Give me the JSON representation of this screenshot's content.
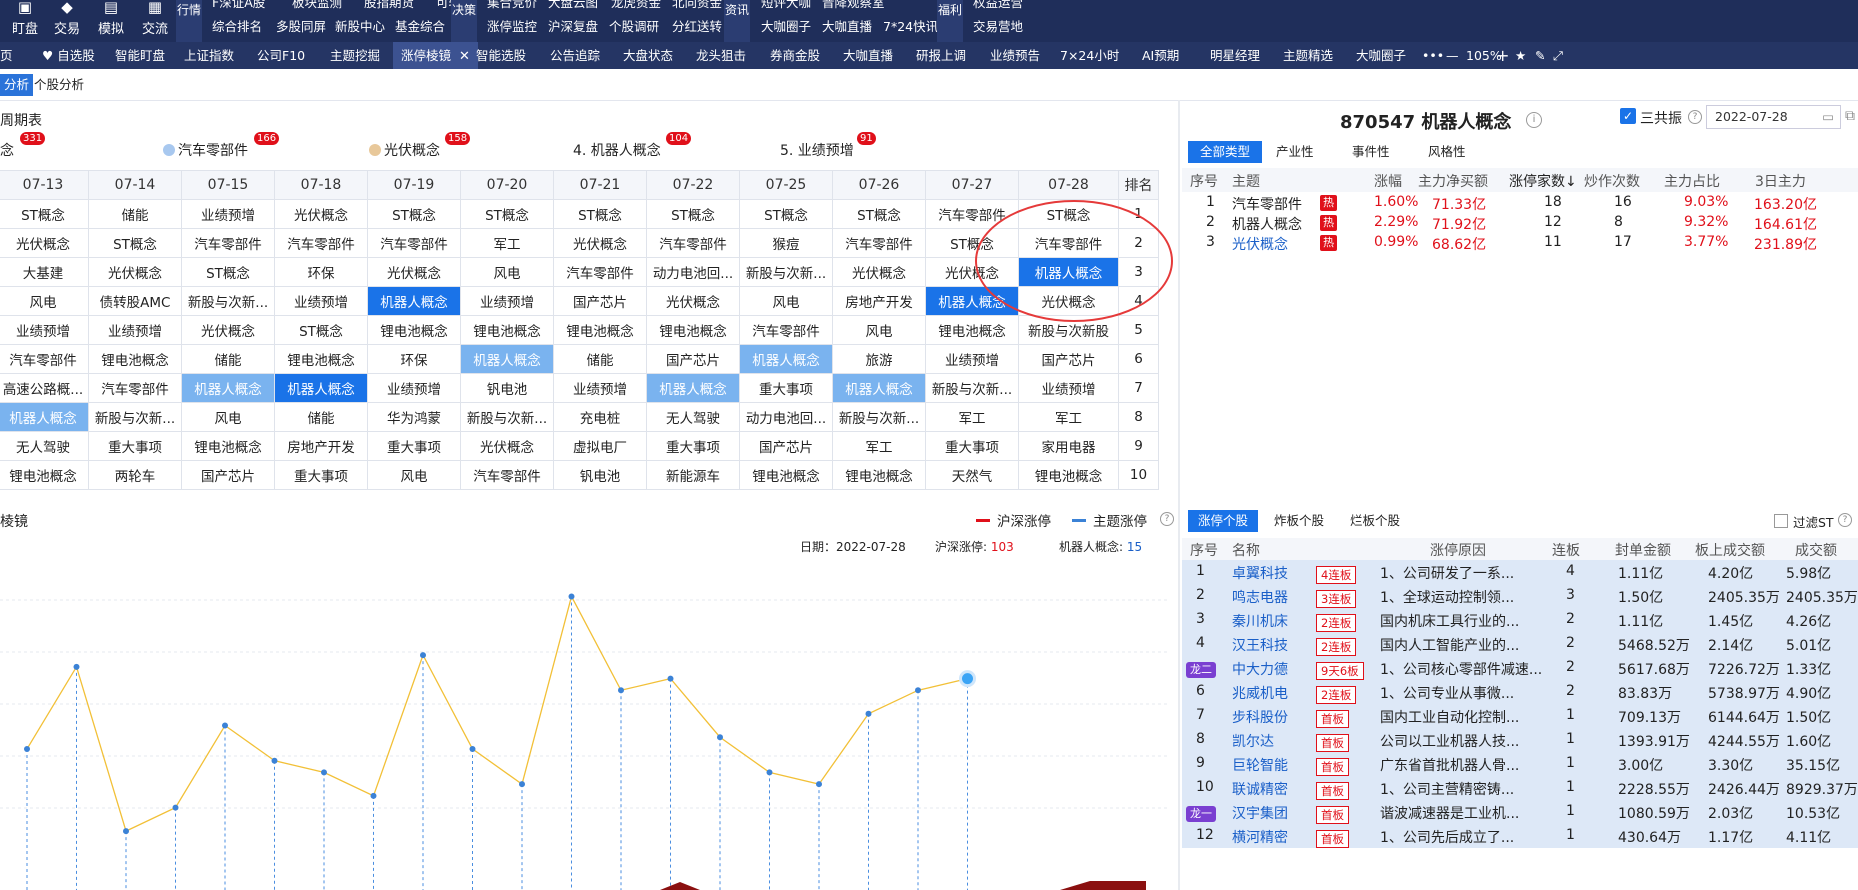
{
  "topnav": {
    "main": [
      {
        "icon": "chart-icon",
        "label": "盯盘"
      },
      {
        "icon": "trade-icon",
        "label": "交易"
      },
      {
        "icon": "sim-icon",
        "label": "模拟"
      },
      {
        "icon": "community-icon",
        "label": "交流"
      }
    ],
    "groups": [
      {
        "head": "行情",
        "row1": [
          "F深证A股",
          "板块监测",
          "股指期货",
          "可转债"
        ],
        "row2": [
          "综合排名",
          "多股同屏",
          "新股中心",
          "基金综合"
        ]
      },
      {
        "head": "决策",
        "row1": [
          "集合竞价",
          "大盘云图",
          "龙虎资金",
          "北向资金"
        ],
        "row2": [
          "涨停监控",
          "沪深复盘",
          "个股调研",
          "分红送转"
        ]
      },
      {
        "head": "资讯",
        "row1": [
          "短评大咖",
          "晋降观察室"
        ],
        "row2": [
          "大咖圈子",
          "大咖直播",
          "7*24快讯"
        ]
      },
      {
        "head": "福利",
        "row1": [
          "权益运营"
        ],
        "row2": [
          "交易营地"
        ]
      }
    ]
  },
  "tabbar": {
    "items": [
      "页",
      "自选股",
      "智能盯盘",
      "上证指数",
      "公司F10",
      "主题挖掘",
      "涨停棱镜",
      "智能选股",
      "公告追踪",
      "大盘状态",
      "龙头狙击",
      "券商金股",
      "大咖直播",
      "研报上调",
      "业绩预告",
      "7×24小时",
      "AI预期",
      "明星经理",
      "主题精选",
      "大咖圈子"
    ],
    "active": "涨停棱镜",
    "zoom": "105%"
  },
  "subtabs": [
    "分析",
    "个股分析"
  ],
  "cycle": {
    "title": "周期表",
    "top": [
      {
        "label": "念",
        "badge": "331"
      },
      {
        "label": "汽车零部件",
        "badge": "166"
      },
      {
        "label": "光伏概念",
        "badge": "158"
      },
      {
        "label": "4. 机器人概念",
        "badge": "104"
      },
      {
        "label": "5. 业绩预增",
        "badge": "91"
      }
    ],
    "dates": [
      "07-13",
      "07-14",
      "07-15",
      "07-18",
      "07-19",
      "07-20",
      "07-21",
      "07-22",
      "07-25",
      "07-26",
      "07-27",
      "07-28"
    ],
    "rank_label": "排名",
    "rows": [
      [
        "ST概念",
        "储能",
        "业绩预增",
        "光伏概念",
        "ST概念",
        "ST概念",
        "ST概念",
        "ST概念",
        "ST概念",
        "ST概念",
        "汽车零部件",
        "ST概念"
      ],
      [
        "光伏概念",
        "ST概念",
        "汽车零部件",
        "汽车零部件",
        "汽车零部件",
        "军工",
        "光伏概念",
        "汽车零部件",
        "猴痘",
        "汽车零部件",
        "ST概念",
        "汽车零部件"
      ],
      [
        "大基建",
        "光伏概念",
        "ST概念",
        "环保",
        "光伏概念",
        "风电",
        "汽车零部件",
        "动力电池回...",
        "新股与次新...",
        "光伏概念",
        "光伏概念",
        "机器人概念"
      ],
      [
        "风电",
        "债转股AMC",
        "新股与次新...",
        "业绩预增",
        "机器人概念",
        "业绩预增",
        "国产芯片",
        "光伏概念",
        "风电",
        "房地产开发",
        "机器人概念",
        "光伏概念"
      ],
      [
        "业绩预增",
        "业绩预增",
        "光伏概念",
        "ST概念",
        "锂电池概念",
        "锂电池概念",
        "锂电池概念",
        "锂电池概念",
        "汽车零部件",
        "风电",
        "锂电池概念",
        "新股与次新股"
      ],
      [
        "汽车零部件",
        "锂电池概念",
        "储能",
        "锂电池概念",
        "环保",
        "机器人概念",
        "储能",
        "国产芯片",
        "机器人概念",
        "旅游",
        "业绩预增",
        "国产芯片"
      ],
      [
        "高速公路概...",
        "汽车零部件",
        "机器人概念",
        "机器人概念",
        "业绩预增",
        "钒电池",
        "业绩预增",
        "机器人概念",
        "重大事项",
        "机器人概念",
        "新股与次新...",
        "业绩预增"
      ],
      [
        "机器人概念",
        "新股与次新...",
        "风电",
        "储能",
        "华为鸿蒙",
        "新股与次新...",
        "充电桩",
        "无人驾驶",
        "动力电池回...",
        "新股与次新...",
        "军工",
        "军工"
      ],
      [
        "无人驾驶",
        "重大事项",
        "锂电池概念",
        "房地产开发",
        "重大事项",
        "光伏概念",
        "虚拟电厂",
        "重大事项",
        "国产芯片",
        "军工",
        "重大事项",
        "家用电器"
      ],
      [
        "锂电池概念",
        "两轮车",
        "国产芯片",
        "重大事项",
        "风电",
        "汽车零部件",
        "钒电池",
        "新能源车",
        "锂电池概念",
        "锂电池概念",
        "天然气",
        "锂电池概念"
      ]
    ],
    "ranks": [
      "1",
      "2",
      "3",
      "4",
      "5",
      "6",
      "7",
      "8",
      "9",
      "10"
    ]
  },
  "mirror": {
    "title": "棱镜",
    "legend_hs": "沪深涨停",
    "legend_theme": "主题涨停",
    "date_label": "日期：",
    "date": "2022-07-28",
    "hs_label": "沪深涨停:",
    "hs_value": "103",
    "theme_label": "机器人概念:",
    "theme_value": "15"
  },
  "chart_data": {
    "type": "line",
    "title": "",
    "series": [
      {
        "name": "主题涨停",
        "values": [
          11,
          18,
          4,
          6,
          13,
          10,
          9,
          7,
          19,
          11,
          8,
          24,
          16,
          17,
          12,
          9,
          8,
          14,
          16,
          17
        ]
      }
    ],
    "ylim": [
      0,
      26
    ],
    "grid": true
  },
  "right": {
    "title": "870547 机器人概念",
    "sgz_label": "三共振",
    "date": "2022-07-28",
    "filter_tabs": [
      "全部类型",
      "产业性",
      "事件性",
      "风格性"
    ],
    "headers": [
      "序号",
      "主题",
      "涨幅",
      "主力净买额",
      "涨停家数↓",
      "炒作次数",
      "主力占比",
      "3日主力"
    ],
    "rows": [
      {
        "no": "1",
        "name": "汽车零部件",
        "hot": "热",
        "chg": "1.60%",
        "net": "71.33亿",
        "limit": "18",
        "times": "16",
        "ratio": "9.03%",
        "d3": "163.20亿"
      },
      {
        "no": "2",
        "name": "机器人概念",
        "hot": "热",
        "chg": "2.29%",
        "net": "71.92亿",
        "limit": "12",
        "times": "8",
        "ratio": "9.32%",
        "d3": "164.61亿"
      },
      {
        "no": "3",
        "name": "光伏概念",
        "hot": "热",
        "chg": "0.99%",
        "net": "68.62亿",
        "limit": "11",
        "times": "17",
        "ratio": "3.77%",
        "d3": "231.89亿"
      }
    ],
    "stock_tabs": [
      "涨停个股",
      "炸板个股",
      "烂板个股"
    ],
    "filter_st": "过滤ST",
    "s_headers": [
      "序号",
      "名称",
      "涨停原因",
      "连板",
      "封单金额",
      "板上成交额",
      "成交额"
    ],
    "stocks": [
      {
        "no": "1",
        "name": "卓翼科技",
        "tag": "4连板",
        "reason": "1、公司研发了一系...",
        "lb": "4",
        "seal": "1.11亿",
        "on": "4.20亿",
        "amt": "5.98亿"
      },
      {
        "no": "2",
        "name": "鸣志电器",
        "tag": "3连板",
        "reason": "1、全球运动控制领...",
        "lb": "3",
        "seal": "1.50亿",
        "on": "2405.35万",
        "amt": "2405.35万"
      },
      {
        "no": "3",
        "name": "秦川机床",
        "tag": "2连板",
        "reason": "国内机床工具行业的...",
        "lb": "2",
        "seal": "1.11亿",
        "on": "1.45亿",
        "amt": "4.26亿"
      },
      {
        "no": "4",
        "name": "汉王科技",
        "tag": "2连板",
        "reason": "国内人工智能产业的...",
        "lb": "2",
        "seal": "5468.52万",
        "on": "2.14亿",
        "amt": "5.01亿"
      },
      {
        "no": "龙二",
        "name": "中大力德",
        "tag": "9天6板",
        "reason": "1、公司核心零部件减速...",
        "lb": "2",
        "seal": "5617.68万",
        "on": "7226.72万",
        "amt": "1.33亿"
      },
      {
        "no": "6",
        "name": "兆威机电",
        "tag": "2连板",
        "reason": "1、公司专业从事微...",
        "lb": "2",
        "seal": "83.83万",
        "on": "5738.97万",
        "amt": "4.90亿"
      },
      {
        "no": "7",
        "name": "步科股份",
        "tag": "首板",
        "reason": "国内工业自动化控制...",
        "lb": "1",
        "seal": "709.13万",
        "on": "6144.64万",
        "amt": "1.50亿"
      },
      {
        "no": "8",
        "name": "凯尔达",
        "tag": "首板",
        "reason": "公司以工业机器人技...",
        "lb": "1",
        "seal": "1393.91万",
        "on": "4244.55万",
        "amt": "1.60亿"
      },
      {
        "no": "9",
        "name": "巨轮智能",
        "tag": "首板",
        "reason": "广东省首批机器人骨...",
        "lb": "1",
        "seal": "3.00亿",
        "on": "3.30亿",
        "amt": "35.15亿"
      },
      {
        "no": "10",
        "name": "联诚精密",
        "tag": "首板",
        "reason": "1、公司主营精密铸...",
        "lb": "1",
        "seal": "2228.55万",
        "on": "2426.44万",
        "amt": "8929.37万"
      },
      {
        "no": "龙一",
        "name": "汉宇集团",
        "tag": "首板",
        "reason": "谐波减速器是工业机...",
        "lb": "1",
        "seal": "1080.59万",
        "on": "2.03亿",
        "amt": "10.53亿"
      },
      {
        "no": "12",
        "name": "横河精密",
        "tag": "首板",
        "reason": "1、公司先后成立了...",
        "lb": "1",
        "seal": "430.64万",
        "on": "1.17亿",
        "amt": "4.11亿"
      }
    ]
  }
}
